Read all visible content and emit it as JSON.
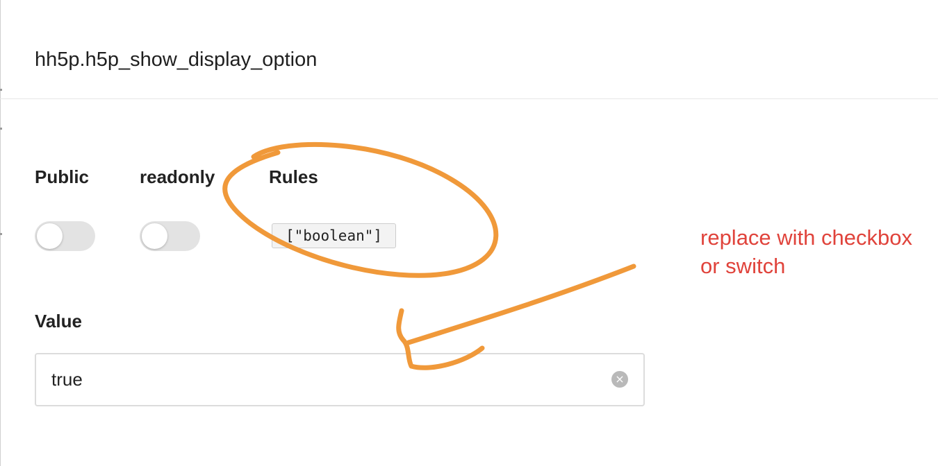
{
  "header": {
    "title": "hh5p.h5p_show_display_option"
  },
  "fields": {
    "public": {
      "label": "Public",
      "on": false
    },
    "readonly": {
      "label": "readonly",
      "on": false
    },
    "rules": {
      "label": "Rules",
      "value": "[\"boolean\"]"
    },
    "value": {
      "label": "Value",
      "current": "true"
    }
  },
  "icons": {
    "clear": "clear-icon",
    "clear_glyph": "×"
  },
  "annotation": {
    "note": "replace with checkbox or switch",
    "stroke_color": "#f0993a",
    "text_color": "#e0433b"
  }
}
